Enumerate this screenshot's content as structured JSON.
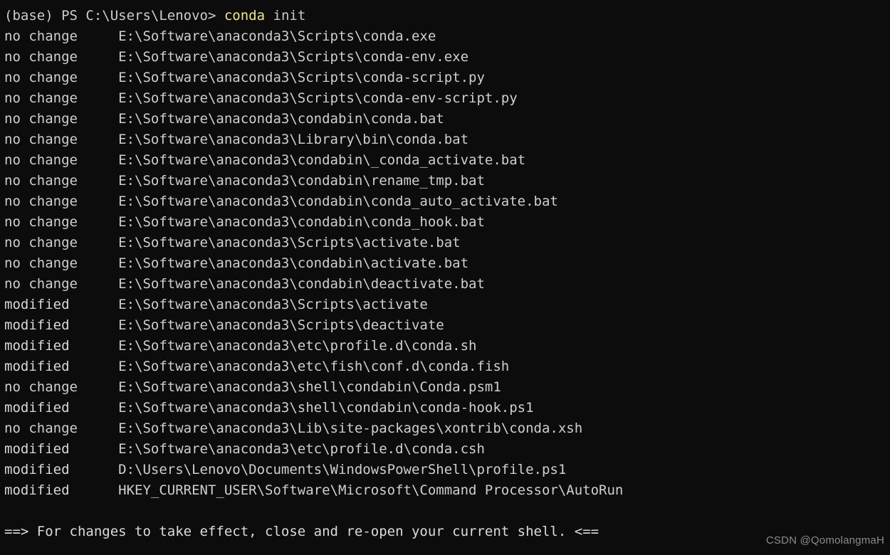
{
  "terminal": {
    "background_color": "#0c0c0c",
    "foreground_color": "#cccccc",
    "highlight_color": "#f1e78b",
    "prompt": {
      "prefix": "(base) PS C:\\Users\\Lenovo> ",
      "command_highlight": "conda",
      "command_rest": " init",
      "full_line": "(base) PS C:\\Users\\Lenovo> conda init"
    },
    "rows": [
      {
        "status": "no change",
        "path": "E:\\Software\\anaconda3\\Scripts\\conda.exe"
      },
      {
        "status": "no change",
        "path": "E:\\Software\\anaconda3\\Scripts\\conda-env.exe"
      },
      {
        "status": "no change",
        "path": "E:\\Software\\anaconda3\\Scripts\\conda-script.py"
      },
      {
        "status": "no change",
        "path": "E:\\Software\\anaconda3\\Scripts\\conda-env-script.py"
      },
      {
        "status": "no change",
        "path": "E:\\Software\\anaconda3\\condabin\\conda.bat"
      },
      {
        "status": "no change",
        "path": "E:\\Software\\anaconda3\\Library\\bin\\conda.bat"
      },
      {
        "status": "no change",
        "path": "E:\\Software\\anaconda3\\condabin\\_conda_activate.bat"
      },
      {
        "status": "no change",
        "path": "E:\\Software\\anaconda3\\condabin\\rename_tmp.bat"
      },
      {
        "status": "no change",
        "path": "E:\\Software\\anaconda3\\condabin\\conda_auto_activate.bat"
      },
      {
        "status": "no change",
        "path": "E:\\Software\\anaconda3\\condabin\\conda_hook.bat"
      },
      {
        "status": "no change",
        "path": "E:\\Software\\anaconda3\\Scripts\\activate.bat"
      },
      {
        "status": "no change",
        "path": "E:\\Software\\anaconda3\\condabin\\activate.bat"
      },
      {
        "status": "no change",
        "path": "E:\\Software\\anaconda3\\condabin\\deactivate.bat"
      },
      {
        "status": "modified",
        "path": "E:\\Software\\anaconda3\\Scripts\\activate"
      },
      {
        "status": "modified",
        "path": "E:\\Software\\anaconda3\\Scripts\\deactivate"
      },
      {
        "status": "modified",
        "path": "E:\\Software\\anaconda3\\etc\\profile.d\\conda.sh"
      },
      {
        "status": "modified",
        "path": "E:\\Software\\anaconda3\\etc\\fish\\conf.d\\conda.fish"
      },
      {
        "status": "no change",
        "path": "E:\\Software\\anaconda3\\shell\\condabin\\Conda.psm1"
      },
      {
        "status": "modified",
        "path": "E:\\Software\\anaconda3\\shell\\condabin\\conda-hook.ps1"
      },
      {
        "status": "no change",
        "path": "E:\\Software\\anaconda3\\Lib\\site-packages\\xontrib\\conda.xsh"
      },
      {
        "status": "modified",
        "path": "E:\\Software\\anaconda3\\etc\\profile.d\\conda.csh"
      },
      {
        "status": "modified",
        "path": "D:\\Users\\Lenovo\\Documents\\WindowsPowerShell\\profile.ps1"
      },
      {
        "status": "modified",
        "path": "HKEY_CURRENT_USER\\Software\\Microsoft\\Command Processor\\AutoRun"
      }
    ],
    "final_message": "==> For changes to take effect, close and re-open your current shell. <=="
  },
  "watermark": {
    "text": "CSDN @QomolangmaH"
  }
}
